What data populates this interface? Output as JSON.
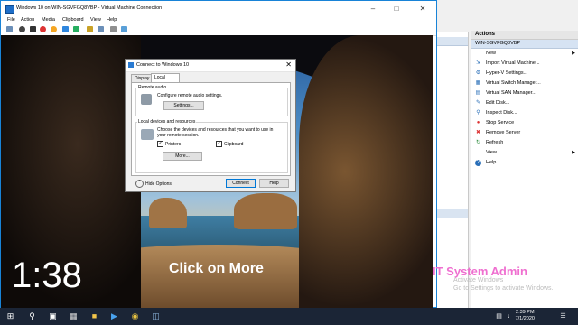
{
  "hyperv": {
    "actions_header": "Actions",
    "vm_name": "WIN-SGVFGQ8VBP",
    "items": [
      {
        "label": "New",
        "icon": "new-icon",
        "submenu": true
      },
      {
        "label": "Import Virtual Machine...",
        "icon": "import-icon"
      },
      {
        "label": "Hyper-V Settings...",
        "icon": "settings-icon"
      },
      {
        "label": "Virtual Switch Manager...",
        "icon": "switch-icon"
      },
      {
        "label": "Virtual SAN Manager...",
        "icon": "san-icon"
      },
      {
        "label": "Edit Disk...",
        "icon": "edit-disk-icon"
      },
      {
        "label": "Inspect Disk...",
        "icon": "inspect-disk-icon"
      },
      {
        "label": "Stop Service",
        "icon": "stop-icon"
      },
      {
        "label": "Remove Server",
        "icon": "remove-icon"
      },
      {
        "label": "Refresh",
        "icon": "refresh-icon"
      },
      {
        "label": "View",
        "icon": "",
        "submenu": true
      },
      {
        "label": "Help",
        "icon": "help-icon"
      }
    ]
  },
  "vm_window": {
    "title": "Windows 10 on WIN-SGVFGQ8VBP - Virtual Machine Connection",
    "menu": [
      "File",
      "Action",
      "Media",
      "Clipboard",
      "View",
      "Help"
    ]
  },
  "dialog": {
    "title": "Connect to Windows 10",
    "tabs": [
      "Display",
      "Local Resources"
    ],
    "remote_audio_label": "Remote audio",
    "remote_audio_desc": "Configure remote audio settings.",
    "settings_button": "Settings...",
    "local_devices_label": "Local devices and resources",
    "local_devices_desc_1": "Choose the devices and resources that you want to use in",
    "local_devices_desc_2": "your remote session.",
    "printers_label": "Printers",
    "clipboard_label": "Clipboard",
    "more_button": "More...",
    "hide_options": "Hide Options",
    "connect_button": "Connect",
    "help_button": "Help"
  },
  "overlay": {
    "timer": "1:38",
    "caption": "Click on More",
    "brand": "IT System Admin",
    "activate_1": "Activate Windows",
    "activate_2": "Go to Settings to activate Windows."
  },
  "taskbar": {
    "time": "2:39 PM",
    "date": "7/1/2020"
  }
}
